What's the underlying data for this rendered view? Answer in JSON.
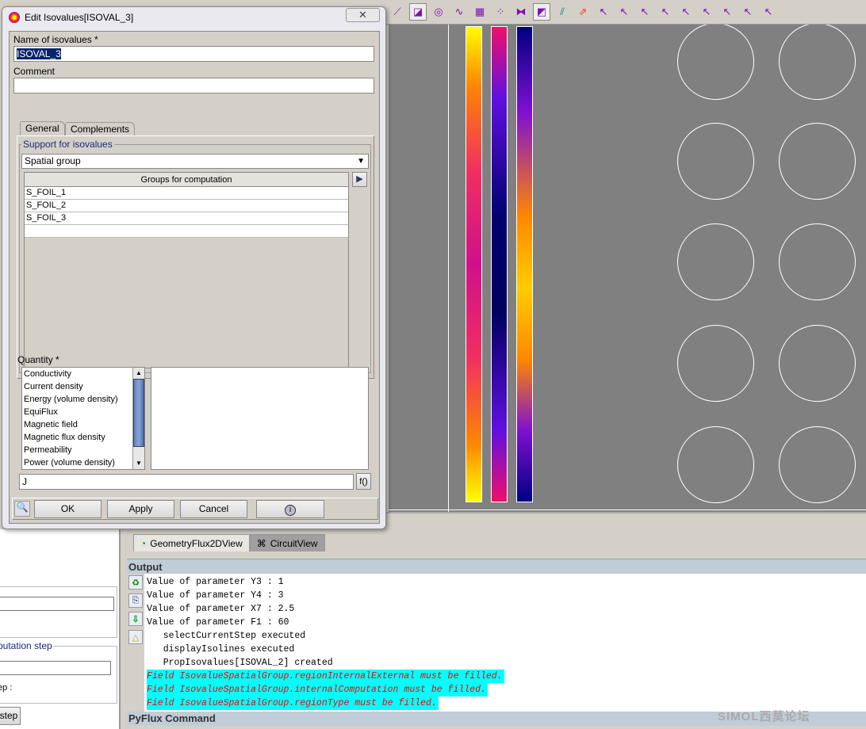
{
  "dialog": {
    "title": "Edit Isovalues[ISOVAL_3]",
    "close_icon": "close-icon",
    "name_label": "Name of isovalues *",
    "name_value": "ISOVAL_3",
    "comment_label": "Comment",
    "comment_value": "",
    "tabs": [
      {
        "label": "General",
        "active": true
      },
      {
        "label": "Complements",
        "active": false
      }
    ],
    "support_legend": "Support for isovalues",
    "support_value": "Spatial group",
    "groups_header": "Groups for computation",
    "groups": [
      "S_FOIL_1",
      "S_FOIL_2",
      "S_FOIL_3"
    ],
    "quantity_label": "Quantity *",
    "quantities": [
      "Conductivity",
      "Current density",
      "Energy (volume density)",
      "EquiFlux",
      "Magnetic field",
      "Magnetic flux density",
      "Permeability",
      "Power (volume density)"
    ],
    "formula_value": "J",
    "formula_button": "f()",
    "ok": "OK",
    "apply": "Apply",
    "cancel": "Cancel",
    "info_icon": "info-icon"
  },
  "toolbar": {
    "icons": [
      "line-icon",
      "face-icon",
      "region-icon",
      "curve-icon",
      "grid-icon",
      "points-icon",
      "mesh-icon",
      "isovalues-icon",
      "isolines-icon",
      "arrows-icon",
      "select-delete-icon",
      "select-query-icon",
      "select-point-icon",
      "select-line-icon",
      "select-face-icon",
      "select-edge-icon",
      "select-region-icon",
      "select-curve-icon",
      "select-grid-icon"
    ]
  },
  "view_tabs": [
    "GeometryFlux2DView",
    "CircuitView"
  ],
  "output": {
    "title": "Output",
    "lines": [
      {
        "text": "Value of parameter Y3 : 1",
        "type": "info"
      },
      {
        "text": "Value of parameter Y4 : 3",
        "type": "info"
      },
      {
        "text": "Value of parameter X7 : 2.5",
        "type": "info"
      },
      {
        "text": "Value of parameter F1 : 60",
        "type": "info"
      },
      {
        "text": "   selectCurrentStep executed",
        "type": "info"
      },
      {
        "text": "   displayIsolines executed",
        "type": "info"
      },
      {
        "text": "   PropIsovalues[ISOVAL_2] created",
        "type": "info"
      },
      {
        "text": "Field IsovalueSpatialGroup.regionInternalExternal must be filled.",
        "type": "error"
      },
      {
        "text": "Field IsovalueSpatialGroup.internalComputation must be filled.",
        "type": "error"
      },
      {
        "text": "Field IsovalueSpatialGroup.regionType must be filled.",
        "type": "error"
      }
    ]
  },
  "pyflux": {
    "title": "PyFlux Command"
  },
  "left_panel": {
    "step_legend": "putation step",
    "step_label": "ep :",
    "step_button": "step"
  },
  "watermark": "SIMOL西莫论坛",
  "colors": {
    "error_text": "#ff0000",
    "error_bg": "#00ffff",
    "viewport_bg": "#808080",
    "selection": "#0a246a"
  }
}
